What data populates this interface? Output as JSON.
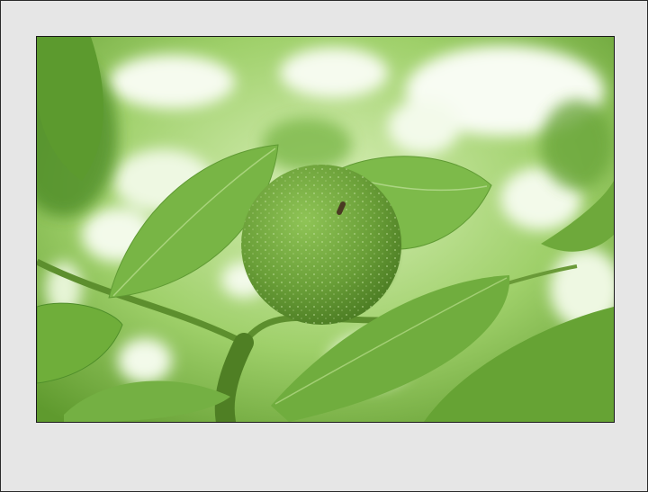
{
  "photo": {
    "subject": "green-walnut",
    "colors": {
      "mat": "#e6e6e6",
      "border": "#1a1a1a",
      "leaf": "#78b545",
      "leaf_dark": "#4f8e2a",
      "fruit": "#6fa83c",
      "highlight": "#f3faea"
    }
  }
}
